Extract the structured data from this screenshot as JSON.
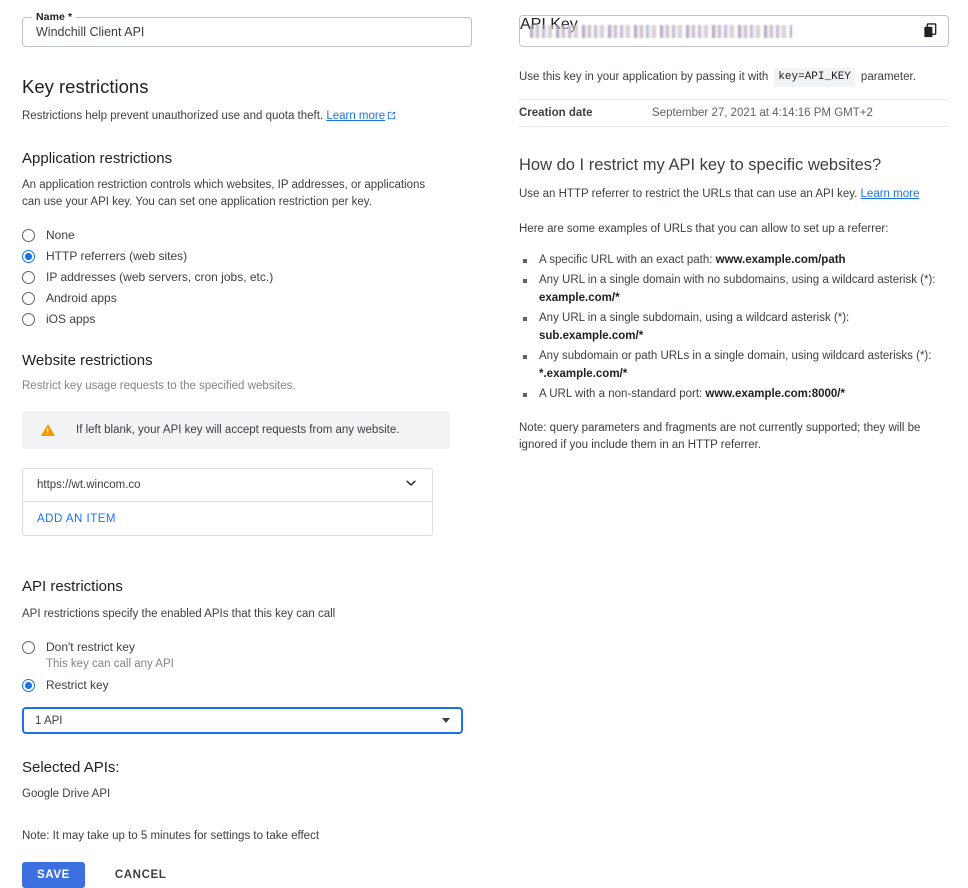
{
  "name_field": {
    "label": "Name *",
    "value": "Windchill Client API"
  },
  "key_restrictions": {
    "title": "Key restrictions",
    "description": "Restrictions help prevent unauthorized use and quota theft.",
    "learn_more": "Learn more"
  },
  "application_restrictions": {
    "title": "Application restrictions",
    "description": "An application restriction controls which websites, IP addresses, or applications can use your API key. You can set one application restriction per key.",
    "options": [
      {
        "label": "None",
        "selected": false
      },
      {
        "label": "HTTP referrers (web sites)",
        "selected": true
      },
      {
        "label": "IP addresses (web servers, cron jobs, etc.)",
        "selected": false
      },
      {
        "label": "Android apps",
        "selected": false
      },
      {
        "label": "iOS apps",
        "selected": false
      }
    ]
  },
  "website_restrictions": {
    "title": "Website restrictions",
    "description": "Restrict key usage requests to the specified websites.",
    "warning": "If left blank, your API key will accept requests from any website.",
    "items": [
      {
        "value": "https://wt.wincom.co"
      }
    ],
    "add_item_label": "ADD AN ITEM"
  },
  "api_restrictions": {
    "title": "API restrictions",
    "description": "API restrictions specify the enabled APIs that this key can call",
    "options": [
      {
        "label": "Don't restrict key",
        "sublabel": "This key can call any API",
        "selected": false
      },
      {
        "label": "Restrict key",
        "sublabel": "",
        "selected": true
      }
    ],
    "select_value": "1 API",
    "selected_apis_title": "Selected APIs:",
    "selected_apis": [
      "Google Drive API"
    ],
    "note": "Note: It may take up to 5 minutes for settings to take effect"
  },
  "actions": {
    "save_label": "SAVE",
    "cancel_label": "CANCEL"
  },
  "api_key_panel": {
    "label": "API Key",
    "value_masked": "",
    "usage_text_before": "Use this key in your application by passing it with",
    "usage_code": "key=API_KEY",
    "usage_text_after": "parameter.",
    "creation_date_label": "Creation date",
    "creation_date_value": "September 27, 2021 at 4:14:16 PM GMT+2"
  },
  "help": {
    "title": "How do I restrict my API key to specific websites?",
    "intro_text": "Use an HTTP referrer to restrict the URLs that can use an API key.",
    "intro_link": "Learn more",
    "examples_intro": "Here are some examples of URLs that you can allow to set up a referrer:",
    "examples": [
      {
        "text": "A specific URL with an exact path: ",
        "code": "www.example.com/path"
      },
      {
        "text": "Any URL in a single domain with no subdomains, using a wildcard asterisk (*): ",
        "code": "example.com/*"
      },
      {
        "text": "Any URL in a single subdomain, using a wildcard asterisk (*): ",
        "code": "sub.example.com/*"
      },
      {
        "text": "Any subdomain or path URLs in a single domain, using wildcard asterisks (*): ",
        "code": "*.example.com/*"
      },
      {
        "text": "A URL with a non-standard port: ",
        "code": "www.example.com:8000/*"
      }
    ],
    "note": "Note: query parameters and fragments are not currently supported; they will be ignored if you include them in an HTTP referrer."
  },
  "colors": {
    "accent_blue": "#1a73e8",
    "save_button": "#3c70e0",
    "warning_orange": "#f29900",
    "text_primary": "#202124",
    "text_secondary": "#5f6368"
  }
}
